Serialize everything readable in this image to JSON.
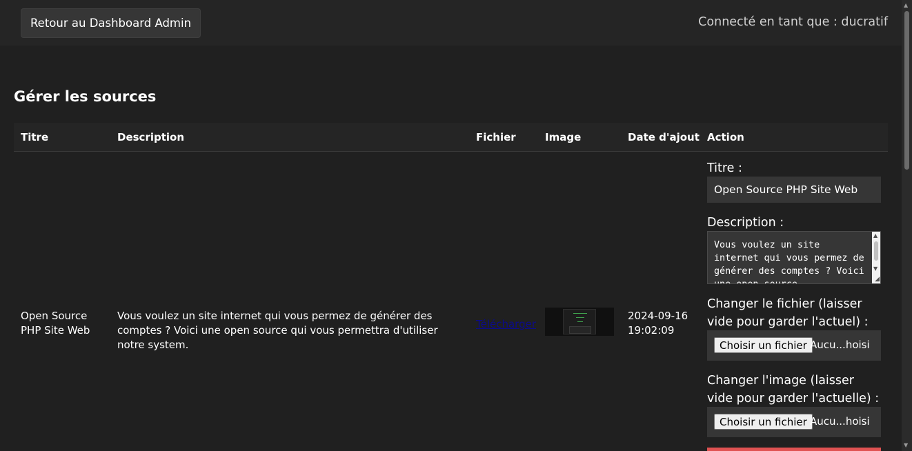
{
  "header": {
    "back_button_label": "Retour au Dashboard Admin",
    "user_info": "Connecté en tant que : ducratif"
  },
  "page_title": "Gérer les sources",
  "table": {
    "columns": [
      "Titre",
      "Description",
      "Fichier",
      "Image",
      "Date d'ajout",
      "Action"
    ],
    "rows": [
      {
        "title": "Open Source PHP Site Web",
        "description": "Vous voulez un site internet qui vous permez de générer des comptes ? Voici une open source qui vous permettra d'utiliser notre system.",
        "file_link": "Télécharger",
        "date": "2024-09-16 19:02:09"
      }
    ]
  },
  "edit_form": {
    "title_label": "Titre :",
    "title_value": "Open Source PHP Site Web",
    "description_label": "Description :",
    "description_value": "Vous voulez un site internet qui vous permez de générer des comptes ? Voici une open source",
    "file_label": "Changer le fichier (laisser vide pour garder l'actuel) :",
    "image_label": "Changer l'image (laisser vide pour garder l'actuelle) :",
    "choose_file_label": "Choisir un fichier",
    "no_file_text": "Aucu...hoisi"
  },
  "colors": {
    "background": "#202020",
    "header_background": "#252525",
    "input_background": "#363636",
    "danger": "#e05252",
    "link": "#0b0b8a"
  }
}
